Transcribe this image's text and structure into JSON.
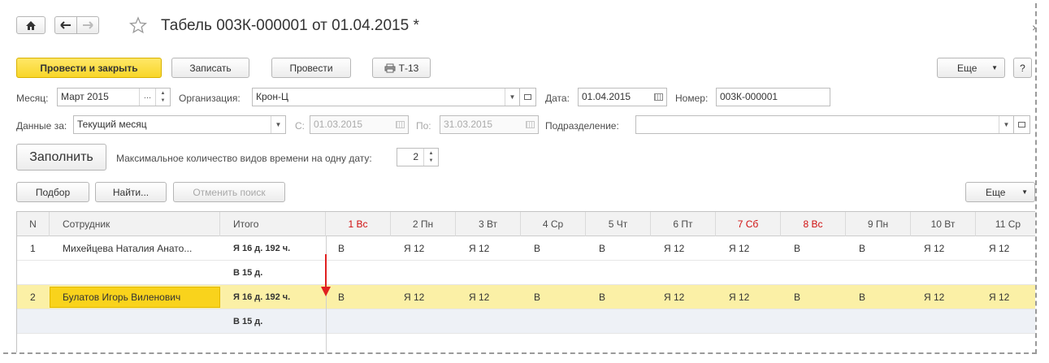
{
  "window": {
    "title": "Табель 003К-000001 от 01.04.2015 *",
    "close_glyph": "×"
  },
  "toolbar": {
    "post_close": "Провести и закрыть",
    "save": "Записать",
    "post": "Провести",
    "print": "Т-13",
    "more": "Еще",
    "help": "?"
  },
  "form": {
    "month_label": "Месяц:",
    "month_value": "Март 2015",
    "org_label": "Организация:",
    "org_value": "Крон-Ц",
    "date_label": "Дата:",
    "date_value": "01.04.2015",
    "number_label": "Номер:",
    "number_value": "003К-000001",
    "data_for_label": "Данные за:",
    "data_for_value": "Текущий месяц",
    "from_label": "С:",
    "from_value": "01.03.2015",
    "to_label": "По:",
    "to_value": "31.03.2015",
    "dept_label": "Подразделение:",
    "dept_value": "",
    "fill_button": "Заполнить",
    "max_types_label": "Максимальное количество видов времени на одну дату:",
    "max_types_value": "2"
  },
  "table_toolbar": {
    "pick": "Подбор",
    "find": "Найти...",
    "cancel_search": "Отменить поиск",
    "more": "Еще"
  },
  "table": {
    "columns": [
      "N",
      "Сотрудник",
      "Итого",
      "1 Вс",
      "2 Пн",
      "3 Вт",
      "4 Ср",
      "5 Чт",
      "6 Пт",
      "7 Сб",
      "8 Вс",
      "9 Пн",
      "10 Вт",
      "11 Ср"
    ],
    "rows": [
      {
        "n": "1",
        "employee": "Михейцева Наталия Анато...",
        "total1": "Я 16 д.  192 ч.",
        "total2": "В 15 д.",
        "days": [
          "В",
          "Я 12",
          "Я 12",
          "В",
          "В",
          "Я 12",
          "Я 12",
          "В",
          "В",
          "Я 12",
          "Я 12"
        ]
      },
      {
        "n": "2",
        "employee": "Булатов Игорь Виленович",
        "total1": "Я 16 д.  192 ч.",
        "total2": "В 15 д.",
        "days": [
          "В",
          "Я 12",
          "Я 12",
          "В",
          "В",
          "Я 12",
          "Я 12",
          "В",
          "В",
          "Я 12",
          "Я 12"
        ]
      }
    ]
  },
  "colors": {
    "primary_button": "#f8d629",
    "selected_row": "#fbf0a6",
    "weekend_header": "#d01010",
    "arrow": "#e02020"
  }
}
